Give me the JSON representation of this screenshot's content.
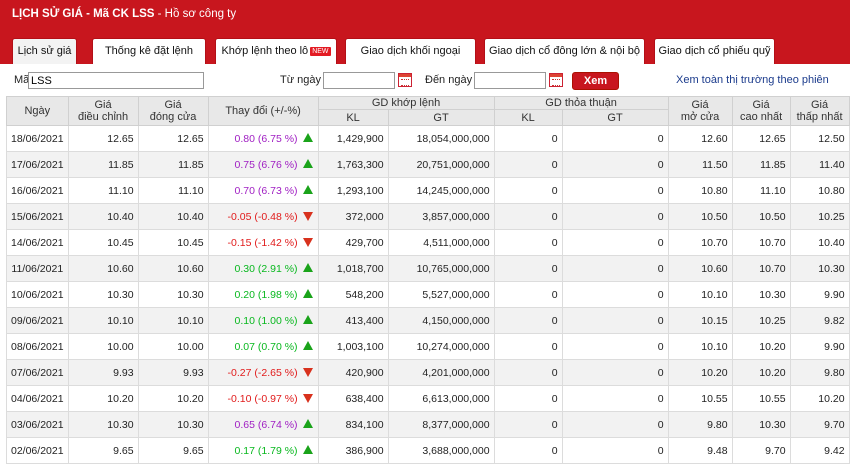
{
  "header": {
    "title_part1": "LỊCH SỬ GIÁ - Mã CK LSS",
    "title_sep": " - ",
    "title_part2": "Hồ sơ công ty"
  },
  "tabs": [
    {
      "label": "Lịch sử giá",
      "active": true
    },
    {
      "label": "Thống kê đặt lệnh"
    },
    {
      "label": "Khớp lệnh theo lô",
      "badge": "NEW"
    },
    {
      "label": "Giao dịch khối ngoại"
    },
    {
      "label": "Giao dịch cổ đông lớn & nội bộ"
    },
    {
      "label": "Giao dịch cổ phiếu quỹ"
    }
  ],
  "filter": {
    "ma_label": "Mã",
    "ma_value": "LSS",
    "tu_ngay_label": "Từ ngày",
    "tu_ngay_value": "",
    "den_ngay_label": "Đến ngày",
    "den_ngay_value": "",
    "xem_label": "Xem",
    "view_all_link": "Xem toàn thị trường theo phiên"
  },
  "table": {
    "headers": {
      "ngay": "Ngày",
      "gia_dieu_chinh_1": "Giá",
      "gia_dieu_chinh_2": "điều chỉnh",
      "gia_dong_cua_1": "Giá",
      "gia_dong_cua_2": "đóng cửa",
      "thay_doi": "Thay đổi (+/-%)",
      "gd_khop_lenh": "GD khớp lệnh",
      "gd_thoa_thuan": "GD thỏa thuận",
      "kl": "KL",
      "gt": "GT",
      "gia_mo_cua_1": "Giá",
      "gia_mo_cua_2": "mở cửa",
      "gia_cao_nhat_1": "Giá",
      "gia_cao_nhat_2": "cao nhất",
      "gia_thap_nhat_1": "Giá",
      "gia_thap_nhat_2": "thấp nhất"
    },
    "rows": [
      {
        "date": "18/06/2021",
        "adj": "12.65",
        "close": "12.65",
        "change": "0.80 (6.75 %)",
        "dir": "up",
        "color": "purple",
        "kl": "1,429,900",
        "gt": "18,054,000,000",
        "tt_kl": "0",
        "tt_gt": "0",
        "open": "12.60",
        "high": "12.65",
        "low": "12.50"
      },
      {
        "date": "17/06/2021",
        "adj": "11.85",
        "close": "11.85",
        "change": "0.75 (6.76 %)",
        "dir": "up",
        "color": "purple",
        "kl": "1,763,300",
        "gt": "20,751,000,000",
        "tt_kl": "0",
        "tt_gt": "0",
        "open": "11.50",
        "high": "11.85",
        "low": "11.40"
      },
      {
        "date": "16/06/2021",
        "adj": "11.10",
        "close": "11.10",
        "change": "0.70 (6.73 %)",
        "dir": "up",
        "color": "purple",
        "kl": "1,293,100",
        "gt": "14,245,000,000",
        "tt_kl": "0",
        "tt_gt": "0",
        "open": "10.80",
        "high": "11.10",
        "low": "10.80"
      },
      {
        "date": "15/06/2021",
        "adj": "10.40",
        "close": "10.40",
        "change": "-0.05 (-0.48 %)",
        "dir": "down",
        "color": "down",
        "kl": "372,000",
        "gt": "3,857,000,000",
        "tt_kl": "0",
        "tt_gt": "0",
        "open": "10.50",
        "high": "10.50",
        "low": "10.25"
      },
      {
        "date": "14/06/2021",
        "adj": "10.45",
        "close": "10.45",
        "change": "-0.15 (-1.42 %)",
        "dir": "down",
        "color": "down",
        "kl": "429,700",
        "gt": "4,511,000,000",
        "tt_kl": "0",
        "tt_gt": "0",
        "open": "10.70",
        "high": "10.70",
        "low": "10.40"
      },
      {
        "date": "11/06/2021",
        "adj": "10.60",
        "close": "10.60",
        "change": "0.30 (2.91 %)",
        "dir": "up",
        "color": "up",
        "kl": "1,018,700",
        "gt": "10,765,000,000",
        "tt_kl": "0",
        "tt_gt": "0",
        "open": "10.60",
        "high": "10.70",
        "low": "10.30"
      },
      {
        "date": "10/06/2021",
        "adj": "10.30",
        "close": "10.30",
        "change": "0.20 (1.98 %)",
        "dir": "up",
        "color": "up",
        "kl": "548,200",
        "gt": "5,527,000,000",
        "tt_kl": "0",
        "tt_gt": "0",
        "open": "10.10",
        "high": "10.30",
        "low": "9.90"
      },
      {
        "date": "09/06/2021",
        "adj": "10.10",
        "close": "10.10",
        "change": "0.10 (1.00 %)",
        "dir": "up",
        "color": "up",
        "kl": "413,400",
        "gt": "4,150,000,000",
        "tt_kl": "0",
        "tt_gt": "0",
        "open": "10.15",
        "high": "10.25",
        "low": "9.82"
      },
      {
        "date": "08/06/2021",
        "adj": "10.00",
        "close": "10.00",
        "change": "0.07 (0.70 %)",
        "dir": "up",
        "color": "up",
        "kl": "1,003,100",
        "gt": "10,274,000,000",
        "tt_kl": "0",
        "tt_gt": "0",
        "open": "10.10",
        "high": "10.20",
        "low": "9.90"
      },
      {
        "date": "07/06/2021",
        "adj": "9.93",
        "close": "9.93",
        "change": "-0.27 (-2.65 %)",
        "dir": "down",
        "color": "down",
        "kl": "420,900",
        "gt": "4,201,000,000",
        "tt_kl": "0",
        "tt_gt": "0",
        "open": "10.20",
        "high": "10.20",
        "low": "9.80"
      },
      {
        "date": "04/06/2021",
        "adj": "10.20",
        "close": "10.20",
        "change": "-0.10 (-0.97 %)",
        "dir": "down",
        "color": "down",
        "kl": "638,400",
        "gt": "6,613,000,000",
        "tt_kl": "0",
        "tt_gt": "0",
        "open": "10.55",
        "high": "10.55",
        "low": "10.20"
      },
      {
        "date": "03/06/2021",
        "adj": "10.30",
        "close": "10.30",
        "change": "0.65 (6.74 %)",
        "dir": "up",
        "color": "purple",
        "kl": "834,100",
        "gt": "8,377,000,000",
        "tt_kl": "0",
        "tt_gt": "0",
        "open": "9.80",
        "high": "10.30",
        "low": "9.70"
      },
      {
        "date": "02/06/2021",
        "adj": "9.65",
        "close": "9.65",
        "change": "0.17 (1.79 %)",
        "dir": "up",
        "color": "up",
        "kl": "386,900",
        "gt": "3,688,000,000",
        "tt_kl": "0",
        "tt_gt": "0",
        "open": "9.48",
        "high": "9.70",
        "low": "9.42"
      }
    ]
  },
  "colors": {
    "brand_red": "#c8161e",
    "up_green": "#09b81f",
    "down_red": "#e11b1b",
    "ceiling_purple": "#a01fc3"
  }
}
